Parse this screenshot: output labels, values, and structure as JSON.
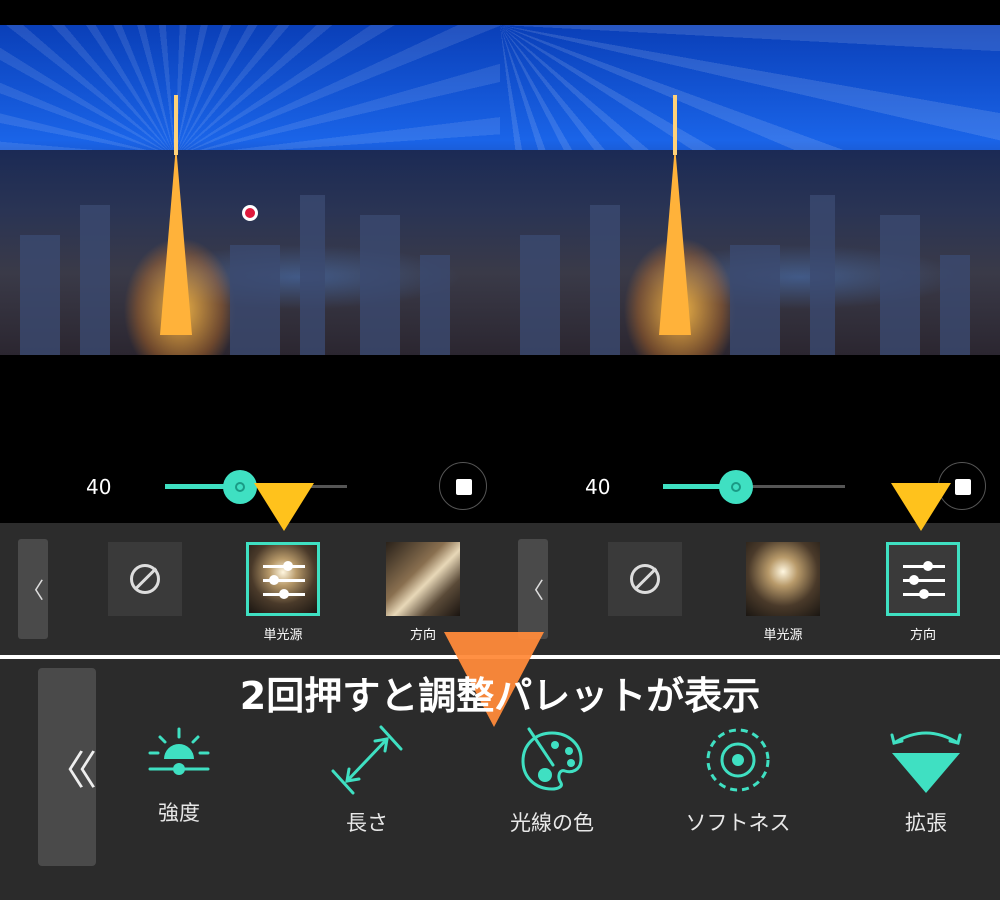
{
  "left_panel": {
    "slider_value": "40",
    "slider_level": 0.41,
    "tiles": [
      {
        "label": "",
        "icon": "none-icon"
      },
      {
        "label": "単光源",
        "selected": true
      },
      {
        "label": "方向"
      }
    ]
  },
  "right_panel": {
    "slider_value": "40",
    "slider_level": 0.4,
    "tiles": [
      {
        "label": "",
        "icon": "none-icon"
      },
      {
        "label": "単光源"
      },
      {
        "label": "方向",
        "selected": true
      }
    ]
  },
  "back_glyph": "〈",
  "big_back_glyph": "〈〈",
  "headline": "2回押すと調整パレットが表示",
  "tools": [
    {
      "label": "強度",
      "icon": "sun-slider-icon"
    },
    {
      "label": "長さ",
      "icon": "length-arrow-icon"
    },
    {
      "label": "光線の色",
      "icon": "palette-icon"
    },
    {
      "label": "ソフトネス",
      "icon": "softness-target-icon"
    },
    {
      "label": "拡張",
      "icon": "expand-fan-icon"
    }
  ],
  "colors": {
    "accent": "#3fe0c2",
    "callout_yellow": "#ffc21c",
    "callout_orange": "#ff8a3a"
  }
}
